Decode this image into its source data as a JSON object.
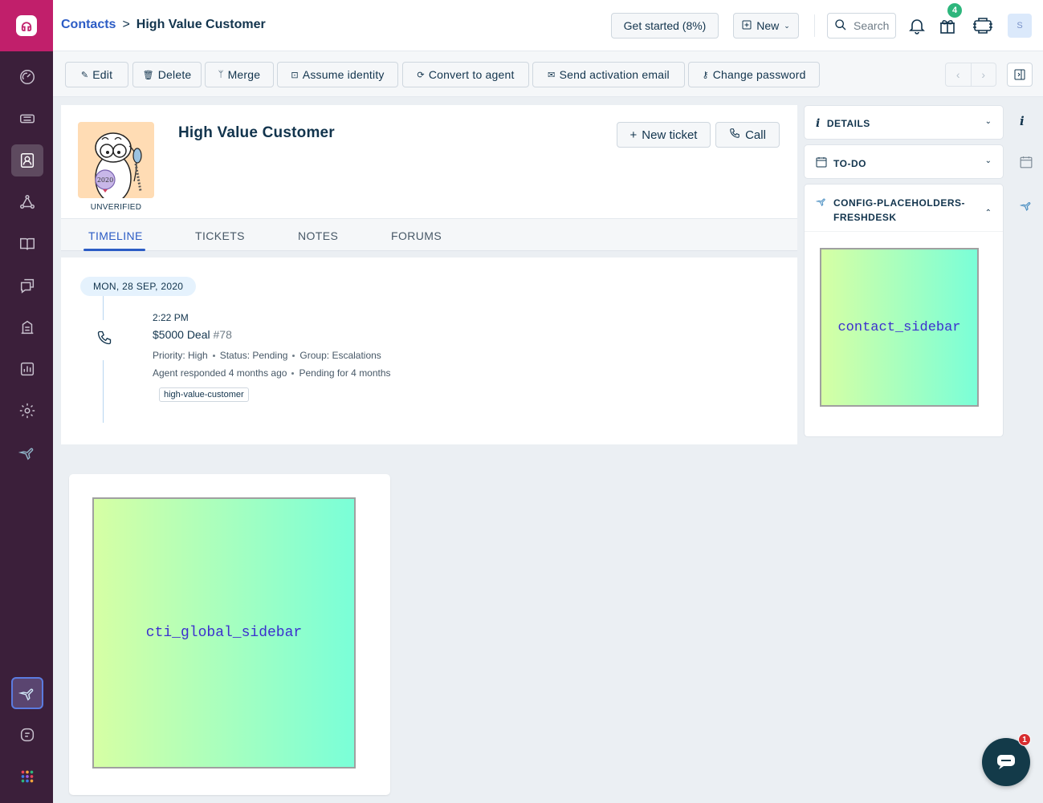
{
  "header": {
    "breadcrumb_parent": "Contacts",
    "breadcrumb_separator": ">",
    "breadcrumb_current": "High Value Customer",
    "get_started_label": "Get started (8%)",
    "new_label": "New",
    "search_placeholder": "Search",
    "notification_badge": "4",
    "avatar_initial": "S"
  },
  "toolbar": {
    "edit": "Edit",
    "delete": "Delete",
    "merge": "Merge",
    "assume_identity": "Assume identity",
    "convert_to_agent": "Convert to agent",
    "send_activation_email": "Send activation email",
    "change_password": "Change password"
  },
  "contact": {
    "name": "High Value Customer",
    "status": "UNVERIFIED",
    "avatar_badge_year": "2020",
    "new_ticket_label": "New ticket",
    "call_label": "Call"
  },
  "tabs": [
    "TIMELINE",
    "TICKETS",
    "NOTES",
    "FORUMS"
  ],
  "active_tab": "TIMELINE",
  "timeline": {
    "date": "MON, 28 SEP, 2020",
    "entry": {
      "time": "2:22 PM",
      "title": "$5000 Deal",
      "ticket_number": "#78",
      "priority": "Priority: High",
      "status": "Status: Pending",
      "group": "Group: Escalations",
      "agent_responded": "Agent responded 4 months ago",
      "pending_for": "Pending for 4 months",
      "tag": "high-value-customer"
    }
  },
  "right_panel": {
    "details": "DETAILS",
    "todo": "TO-DO",
    "app_title_line1": "CONFIG-PLACEHOLDERS-",
    "app_title_line2": "FRESHDESK",
    "app_placeholder": "contact_sidebar"
  },
  "cti": {
    "placeholder": "cti_global_sidebar"
  },
  "chat": {
    "badge": "1"
  },
  "colors": {
    "brand": "#c11f6b",
    "sidebar_bg": "#3b1f3a",
    "link": "#2c5cc5",
    "gradient_start": "#d6ffa4",
    "gradient_end": "#7affd8"
  }
}
